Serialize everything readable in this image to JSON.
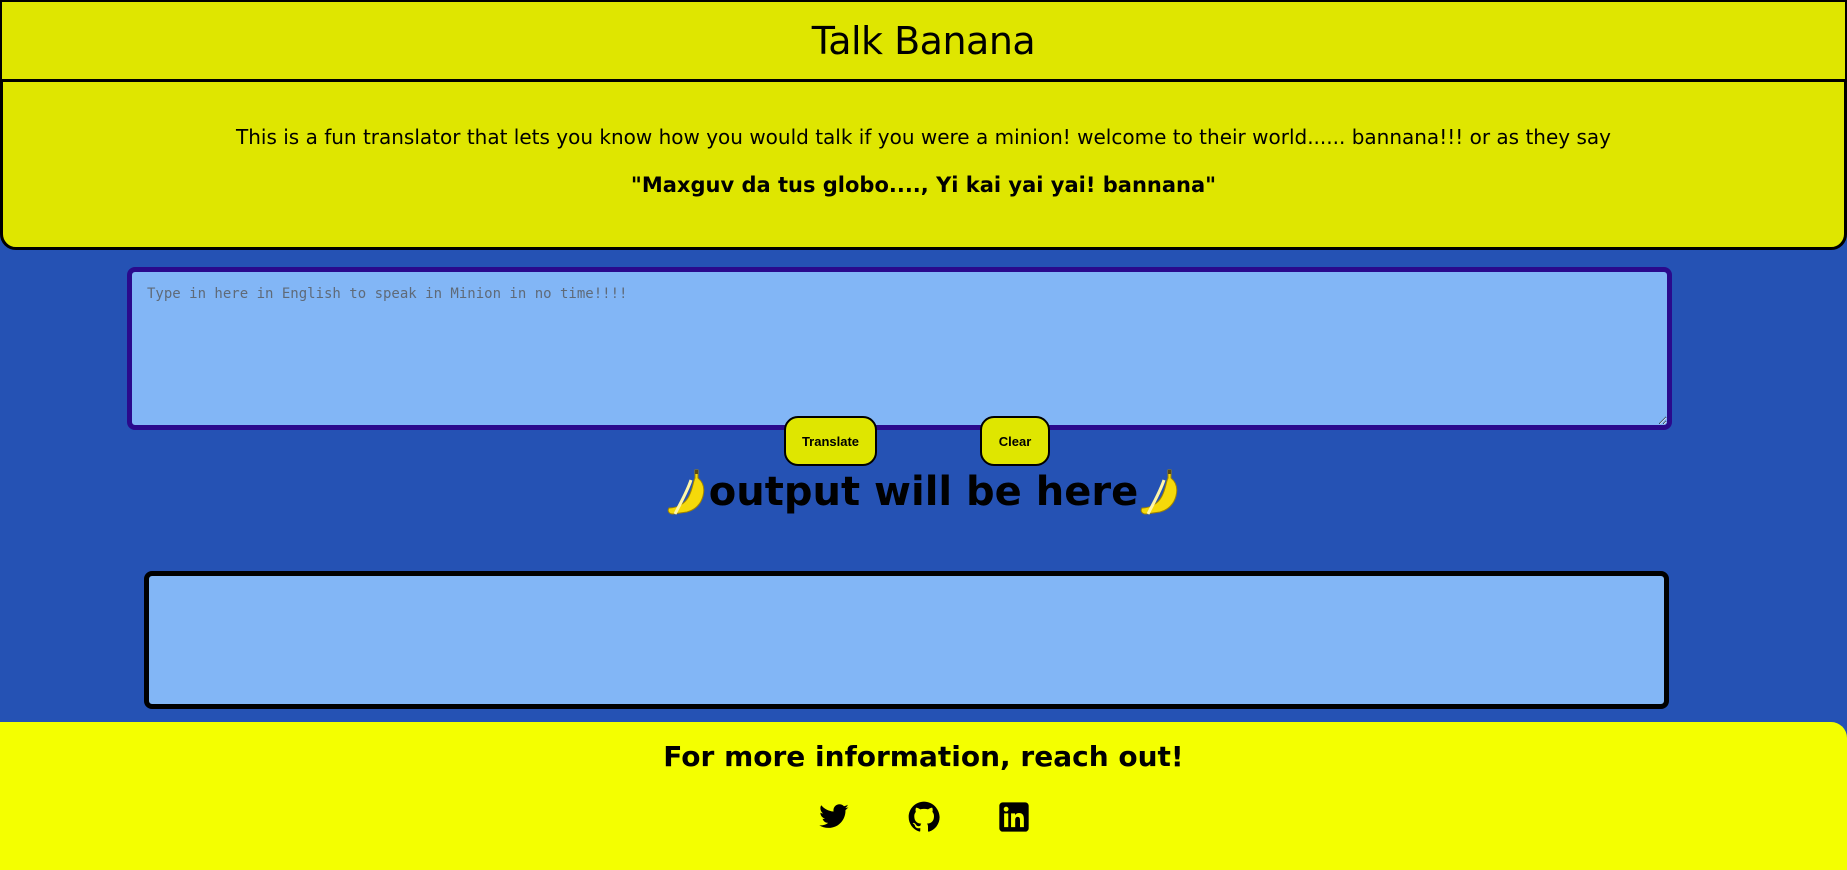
{
  "header": {
    "title": "Talk Banana"
  },
  "intro": {
    "description": "This is a fun translator that lets you know how you would talk if you were a minion! welcome to their world...... bannana!!! or as they say",
    "quote": "\"Maxguv da tus globo...., Yi kai yai yai! bannana\""
  },
  "input": {
    "placeholder": "Type in here in English to speak in Minion in no time!!!!",
    "value": ""
  },
  "buttons": {
    "translate_label": "Translate",
    "clear_label": "Clear"
  },
  "output": {
    "heading": "output will be here",
    "heading_icon": "banana-emoji",
    "text": ""
  },
  "footer": {
    "heading": "For more information, reach out!",
    "social": [
      {
        "icon": "twitter-icon"
      },
      {
        "icon": "github-icon"
      },
      {
        "icon": "linkedin-icon"
      }
    ]
  },
  "colors": {
    "background": "#2552b4",
    "header_bg": "#dfe600",
    "footer_bg": "#f4ff00",
    "input_bg": "#82b6f6",
    "input_border": "#2a0a8c"
  }
}
